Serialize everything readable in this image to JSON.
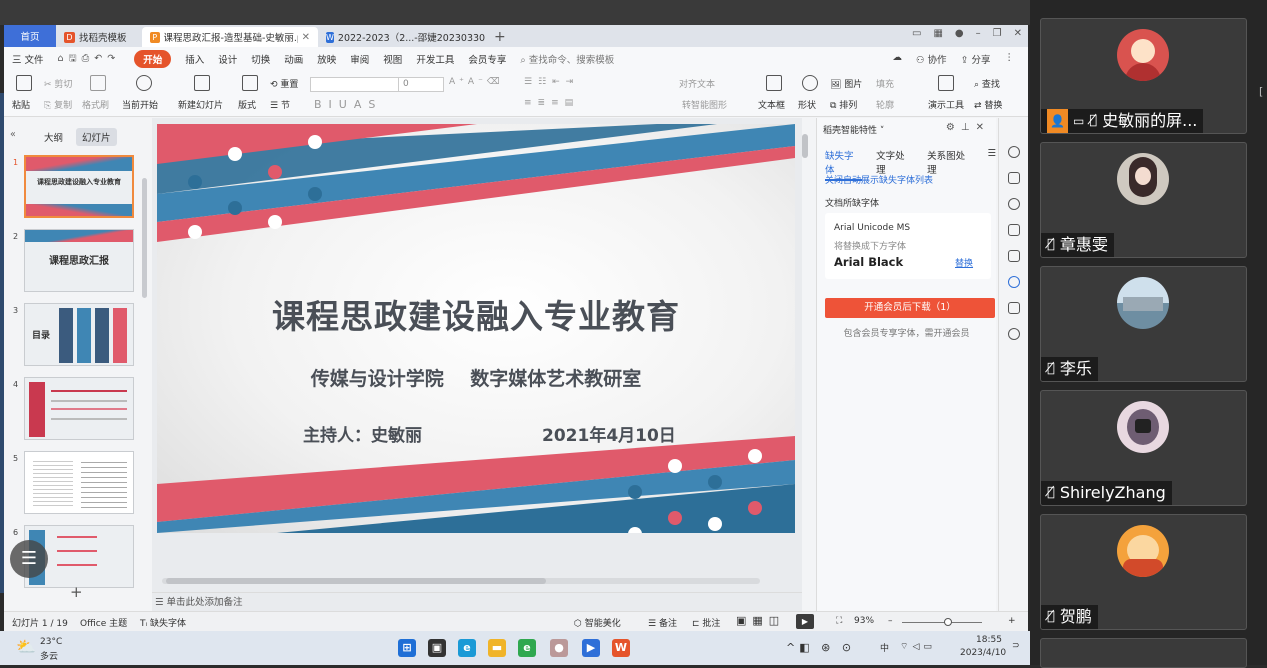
{
  "tabs": [
    {
      "label": "首页",
      "type": "home"
    },
    {
      "label": "找稻壳模板",
      "icon": "D"
    },
    {
      "label": "课程思政汇报-造型基础-史敏丽.pptx",
      "icon": "P",
      "active": true
    },
    {
      "label": "2022-2023（2...-邵婕20230330",
      "icon": "W"
    }
  ],
  "menu": {
    "file": "三 文件",
    "start": "开始",
    "items": [
      "插入",
      "设计",
      "切换",
      "动画",
      "放映",
      "审阅",
      "视图",
      "开发工具",
      "会员专享"
    ],
    "search": "查找命令、搜索模板",
    "cowork": "协作",
    "share": "分享"
  },
  "toolbar": {
    "paste": "粘贴",
    "cut": "剪切",
    "copy": "复制",
    "format_painter": "格式刷",
    "play_from_current": "当前开始",
    "new_slide": "新建幻灯片",
    "layout": "版式",
    "section": "节",
    "reset": "重置",
    "font_size": "0",
    "bold": "B",
    "italic": "I",
    "underline": "U",
    "convert_smart": "转智能图形",
    "align_text": "对齐文本",
    "textbox": "文本框",
    "shape": "形状",
    "arrange": "排列",
    "image": "图片",
    "fill": "填充",
    "outline": "轮廓",
    "present_tool": "演示工具",
    "find": "查找",
    "replace": "替换"
  },
  "left_panel": {
    "outline_tab": "大纲",
    "slides_tab": "幻灯片",
    "add": "+"
  },
  "thumbs": [
    {
      "num": "1",
      "title": "课程思政建设融入专业教育"
    },
    {
      "num": "2",
      "title": "课程思政汇报"
    },
    {
      "num": "3",
      "title": "目录"
    },
    {
      "num": "4",
      "title": ""
    },
    {
      "num": "5",
      "title": ""
    },
    {
      "num": "6",
      "title": ""
    }
  ],
  "slide": {
    "title": "课程思政建设融入专业教育",
    "subtitle": "传媒与设计学院 数字媒体艺术教研室",
    "host": "主持人：史敏丽",
    "date": "2021年4月10日"
  },
  "notes_placeholder": "单击此处添加备注",
  "right_panel": {
    "header": "稻壳智能特性",
    "tabs": [
      "缺失字体",
      "文字处理",
      "关系图处理"
    ],
    "link": "关闭自动展示缺失字体列表",
    "section_label": "文档所缺字体",
    "missing_font": "Arial Unicode MS",
    "replace_hint": "将替换成下方字体",
    "replacement": "Arial Black",
    "replace_link": "替换",
    "button": "开通会员后下载（1）",
    "note": "包含会员专享字体，需开通会员"
  },
  "status": {
    "slide_pos": "幻灯片 1 / 19",
    "theme": "Office 主题",
    "missing_font": "缺失字体",
    "beautify": "智能美化",
    "notes": "备注",
    "comment": "批注",
    "zoom": "93%"
  },
  "taskbar": {
    "temp": "23°C",
    "weather": "多云",
    "ime": "中",
    "time": "18:55",
    "date": "2023/4/10"
  },
  "participants": [
    {
      "name": "史敏丽的屏...",
      "avatar_color": "#d9534f"
    },
    {
      "name": "章惠雯",
      "avatar_color": "#cfc9c0"
    },
    {
      "name": "李乐",
      "avatar_color": "#8fb3c9"
    },
    {
      "name": "ShirelyZhang",
      "avatar_color": "#6e5d72"
    },
    {
      "name": "贺鹏",
      "avatar_color": "#f4a23c"
    }
  ]
}
